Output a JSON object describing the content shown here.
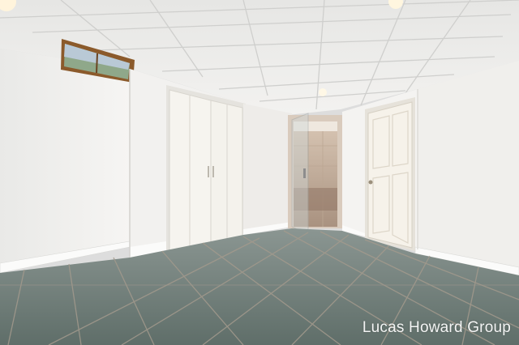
{
  "photo": {
    "subject": "basement room with closet, walk-in shower and tile floor",
    "watermark_text": "Lucas Howard Group",
    "colors": {
      "ceiling": "#e9e9e8",
      "wall": "#f1f0ee",
      "floor": "#6f7d78",
      "grout": "#a89f92",
      "door": "#f5f3ee",
      "shower_tile": "#c9b7a6"
    }
  }
}
